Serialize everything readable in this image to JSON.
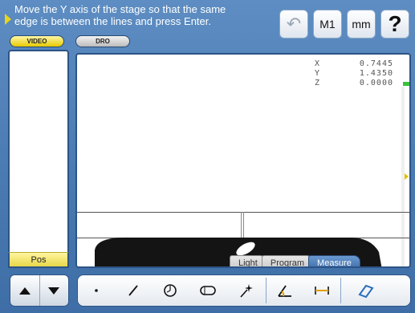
{
  "instruction": {
    "line1": "Move the Y axis of the stage so that the same",
    "line2": "edge is between the lines and press Enter."
  },
  "mode_tabs": {
    "video": "VIDEO",
    "dro": "DRO"
  },
  "top_buttons": {
    "undo": "↶",
    "m1": "M1",
    "mm": "mm",
    "help": "?"
  },
  "left_panel": {
    "pos_label": "Pos"
  },
  "dro": [
    {
      "axis": "X",
      "value": "0.7445"
    },
    {
      "axis": "Y",
      "value": "1.4350"
    },
    {
      "axis": "Z",
      "value": "0.0000"
    }
  ],
  "sub_tabs": [
    "Light",
    "Program",
    "Measure"
  ],
  "active_sub_tab": "Measure",
  "toolbar_icons": [
    "point-icon",
    "line-icon",
    "circle-icon",
    "slot-icon",
    "edge-sparkle-icon",
    "angle-icon",
    "distance-icon",
    "rectangle-icon"
  ],
  "colors": {
    "background": "#4c7cb4",
    "accent_yellow": "#e8d31d",
    "active_tab": "#3e6ca8"
  }
}
